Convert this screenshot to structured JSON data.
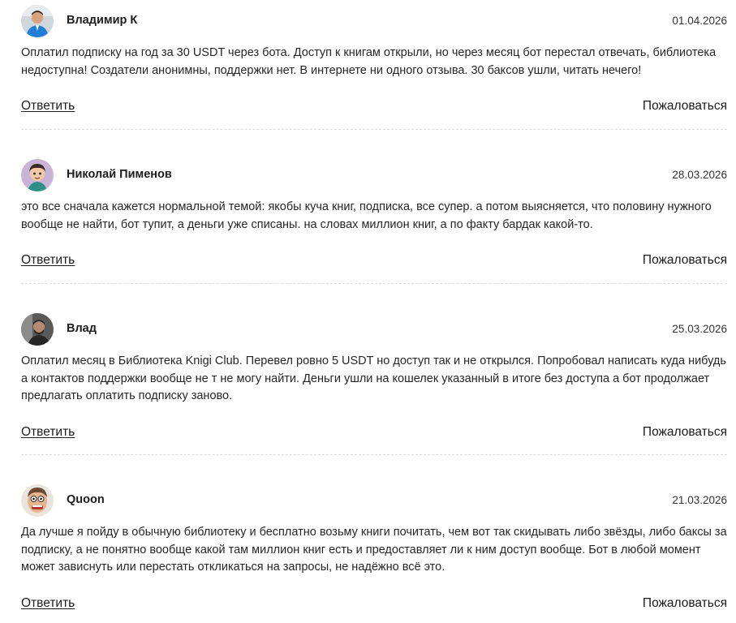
{
  "comments": [
    {
      "author": "Владимир К",
      "date": "01.04.2026",
      "avatar_icon": "user-avatar-blue-jacket",
      "text": "Оплатил подписку на год за 30 USDT через бота. Доступ к книгам открыли, но через месяц бот перестал отвечать, библиотека недоступна! Создатели анонимны, поддержки нет. В интернете ни одного отзыва. 30 баксов ушли, читать нечего!",
      "reply_label": "Ответить",
      "report_label": "Пожаловаться"
    },
    {
      "author": "Николай Пименов",
      "date": "28.03.2026",
      "avatar_icon": "user-avatar-cartoon-man",
      "text": "это все сначала кажется нормальной темой: якобы куча книг, подписка, все супер. а потом выясняется, что половину нужного вообще не найти, бот тупит, а деньги уже списаны. на словах миллион книг, а по факту бардак какой-то.",
      "reply_label": "Ответить",
      "report_label": "Пожаловаться"
    },
    {
      "author": "Влад",
      "date": "25.03.2026",
      "avatar_icon": "user-avatar-photo",
      "text": "Оплатил месяц в Библиотека Knigi Club. Перевел ровно 5 USDT но доступ так и не открылся. Попробовал написать куда нибудь а контактов поддержки вообще не т не могу найти. Деньги ушли на кошелек указанный в итоге без доступа а бот продолжает предлагать оплатить подписку заново.",
      "reply_label": "Ответить",
      "report_label": "Пожаловаться"
    },
    {
      "author": "Quoon",
      "date": "21.03.2026",
      "avatar_icon": "user-avatar-cartoon-face",
      "text": "Да лучше я пойду в обычную библиотеку и бесплатно возьму книги почитать, чем вот так скидывать либо звёзды, либо баксы за подписку, а не понятно вообще какой там миллион книг есть и предоставляет ли к ним доступ вообще. Бот в любой момент может зависнуть или перестать откликаться на запросы, не надёжно всё это.",
      "reply_label": "Ответить",
      "report_label": "Пожаловаться"
    }
  ]
}
